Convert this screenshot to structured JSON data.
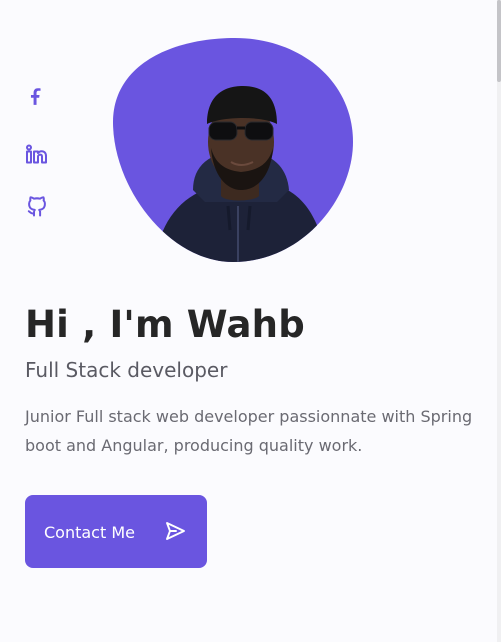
{
  "social": {
    "facebook_icon": "facebook-icon",
    "linkedin_icon": "linkedin-icon",
    "github_icon": "github-icon"
  },
  "profile": {
    "avatar_icon": "profile-photo"
  },
  "hero": {
    "title": "Hi , I'm Wahb",
    "subtitle": "Full Stack developer",
    "description": "Junior Full stack web developer passionnate with Spring boot and Angular, producing quality work.",
    "cta_label": "Contact Me",
    "cta_icon": "send-icon"
  },
  "colors": {
    "accent": "#6a55e0",
    "title": "#262626",
    "subtitle": "#5a5a63",
    "text": "#6a6a72",
    "background": "#fbfbfe"
  }
}
